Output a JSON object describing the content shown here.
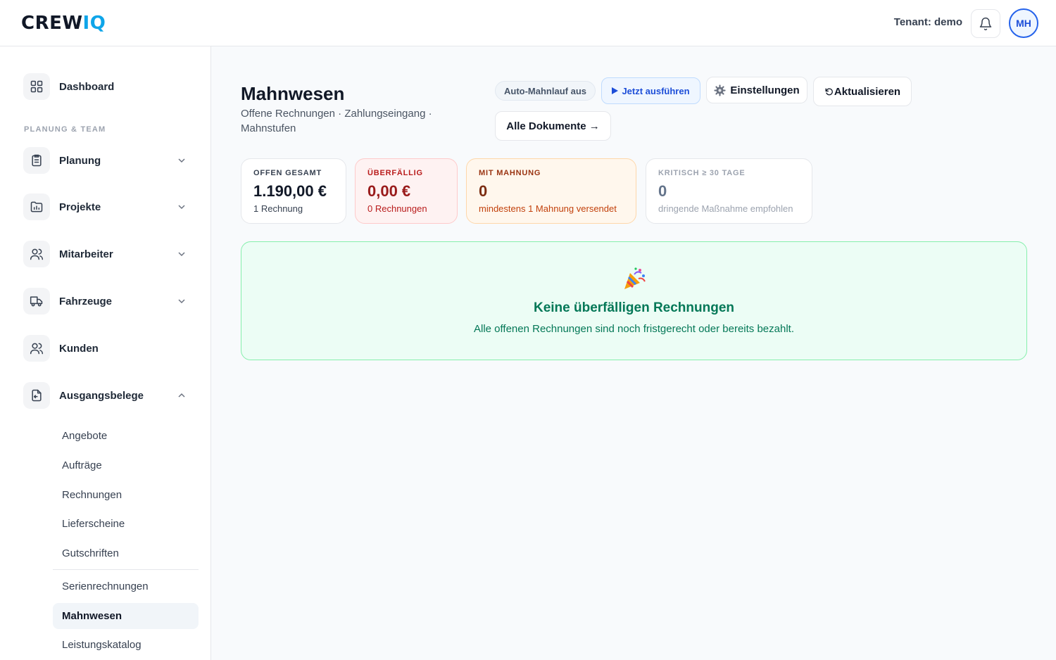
{
  "header": {
    "logo_text": "CREW",
    "logo_accent": "IQ",
    "tenant_label": "Tenant: demo",
    "avatar_initials": "MH",
    "accent_color": "#2563eb"
  },
  "sidebar": {
    "dashboard": {
      "label": "Dashboard",
      "icon": "grid-icon"
    },
    "section_label": "PLANUNG & TEAM",
    "groups": [
      {
        "label": "Planung",
        "icon": "clipboard-icon",
        "expanded": false
      },
      {
        "label": "Projekte",
        "icon": "folder-chart-icon",
        "expanded": false
      },
      {
        "label": "Mitarbeiter",
        "icon": "users-icon",
        "expanded": false
      },
      {
        "label": "Fahrzeuge",
        "icon": "truck-icon",
        "expanded": false
      },
      {
        "label": "Kunden",
        "icon": "users-icon",
        "expanded": false
      },
      {
        "label": "Ausgangsbelege",
        "icon": "document-out-icon",
        "expanded": true
      }
    ],
    "subitems": [
      {
        "label": "Angebote"
      },
      {
        "label": "Aufträge"
      },
      {
        "label": "Rechnungen"
      },
      {
        "label": "Lieferscheine"
      },
      {
        "label": "Gutschriften"
      },
      {
        "label": "Serienrechnungen"
      },
      {
        "label": "Mahnwesen",
        "active": true
      },
      {
        "label": "Leistungskatalog"
      }
    ]
  },
  "main": {
    "title": "Mahnwesen",
    "subtitle": "Offene Rechnungen · Zahlungseingang · Mahnstufen",
    "auto_status": "Auto-Mahnlauf aus",
    "run_label": "Jetzt ausführen",
    "settings_label": "Einstellungen",
    "refresh_label": "Aktualisieren",
    "docs_label": "Alle Dokumente →",
    "kpis": {
      "open": {
        "label": "OFFEN GESAMT",
        "value": "1.190,00 €",
        "note": "1 Rechnung"
      },
      "overdue": {
        "label": "ÜBERFÄLLIG",
        "value": "0,00 €",
        "note": "0 Rechnungen"
      },
      "dunned": {
        "label": "MIT MAHNUNG",
        "value": "0",
        "note": "mindestens 1 Mahnung versendet"
      },
      "critical": {
        "label": "KRITISCH ≥ 30 TAGE",
        "value": "0",
        "note": "dringende Maßnahme empfohlen"
      }
    },
    "empty_state": {
      "icon": "party-popper-icon",
      "title": "Keine überfälligen Rechnungen",
      "text": "Alle offenen Rechnungen sind noch fristgerecht oder bereits bezahlt."
    }
  }
}
